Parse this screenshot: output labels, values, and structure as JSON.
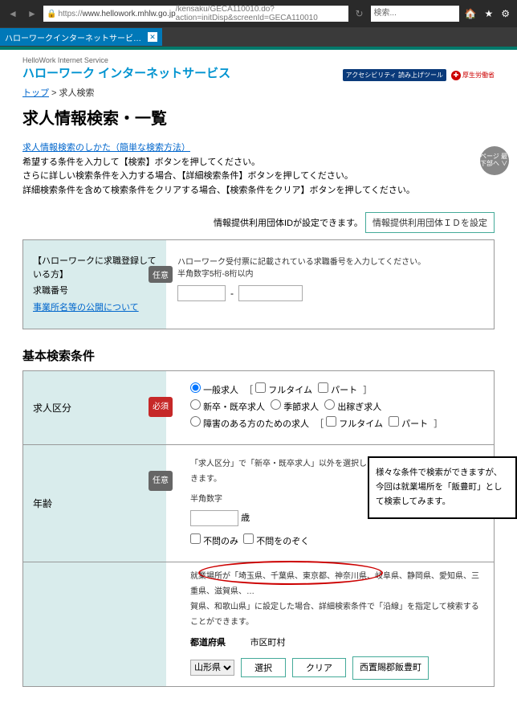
{
  "browser": {
    "url_prefix": "https://",
    "url_host": "www.hellowork.mhlw.go.jp",
    "url_path": "/kensaku/GECA110010.do?action=initDisp&screenId=GECA110010",
    "search_placeholder": "検索...",
    "tab_title": "ハローワークインターネットサービ…"
  },
  "header": {
    "brand_sub": "HelloWork Internet Service",
    "brand_main": "ハローワーク インターネットサービス",
    "badge1": "アクセシビリティ\n読み上げツール",
    "badge2": "厚生労働省"
  },
  "breadcrumb": {
    "top": "トップ",
    "sep": " > ",
    "here": "求人検索"
  },
  "page_title": "求人情報検索・一覧",
  "instructions": {
    "link": "求人情報検索のしかた（簡単な検索方法）",
    "l1": "希望する条件を入力して【検索】ボタンを押してください。",
    "l2": "さらに詳しい検索条件を入力する場合、【詳細検索条件】ボタンを押してください。",
    "l3": "詳細検索条件を含めて検索条件をクリアする場合、【検索条件をクリア】ボタンを押してください。"
  },
  "notice": {
    "text": "情報提供利用団体IDが設定できます。",
    "btn": "情報提供利用団体ＩＤを設定"
  },
  "scroll_btn": "ページ\n最下部へ\n∨",
  "panel1": {
    "title": "【ハローワークに求職登録している方】",
    "label": "求職番号",
    "link": "事業所名等の公開について",
    "pill": "任意",
    "help1": "ハローワーク受付票に記載されている求職番号を入力してください。",
    "help2": "半角数字5桁-8桁以内",
    "dash": "-"
  },
  "section_title": "基本検索条件",
  "row_kubun": {
    "label": "求人区分",
    "pill": "必須",
    "r1": "一般求人",
    "c1a": "フルタイム",
    "c1b": "パート",
    "r2": "新卒・既卒求人",
    "r3": "季節求人",
    "r4": "出稼ぎ求人",
    "r5": "障害のある方のための求人",
    "c5a": "フルタイム",
    "c5b": "パート"
  },
  "row_age": {
    "label": "年齢",
    "pill": "任意",
    "help1": "「求人区分」で「新卒・既卒求人」以外を選択した場合のみ、検索条件に設定できます。",
    "help2": "半角数字",
    "unit": "歳",
    "c1": "不問のみ",
    "c2": "不問をのぞく"
  },
  "row_region": {
    "head_pref": "都道府県",
    "head_city": "市区町村",
    "note": "就業場所が「埼玉県、千葉県、東京都、神奈川県、岐阜県、静岡県、愛知県、三重県、滋賀県、…\n賀県、和歌山県」に設定した場合、詳細検索条件で「沿線」を指定して検索することができます。",
    "pref_sel": "山形県",
    "btn_select": "選択",
    "btn_clear": "クリア",
    "chip": "西置賜郡飯豊町"
  },
  "annotation": "様々な条件で検索ができますが、今回は就業場所を「飯豊町」として検索してみます。"
}
